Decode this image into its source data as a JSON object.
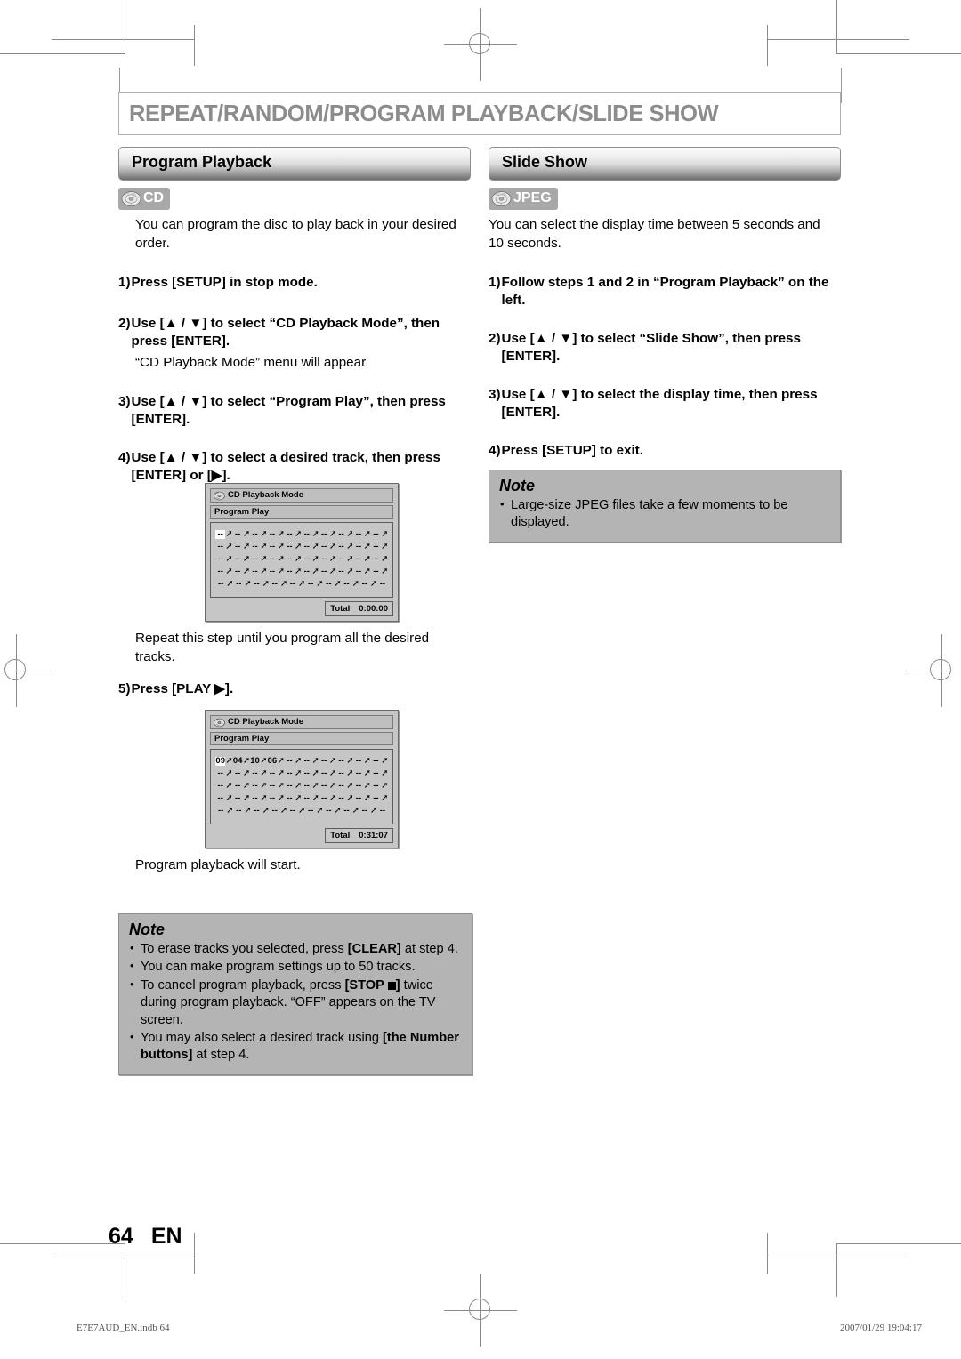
{
  "chapter": {
    "title": "REPEAT/RANDOM/PROGRAM PLAYBACK/SLIDE SHOW"
  },
  "left": {
    "section_title": "Program Playback",
    "badge": {
      "icon": "disc-icon",
      "label": "CD"
    },
    "intro": "You can program the disc to play back in your desired order.",
    "steps": [
      {
        "num": "1)",
        "text": "Press [SETUP] in stop mode."
      },
      {
        "num": "2)",
        "text": "Use [▲ / ▼] to select “CD Playback Mode”, then press [ENTER].",
        "sub": "“CD Playback Mode” menu will appear."
      },
      {
        "num": "3)",
        "text": "Use [▲ / ▼] to select “Program Play”, then press [ENTER]."
      },
      {
        "num": "4)",
        "text": "Use [▲ / ▼] to select a desired track, then press [ENTER] or [▶]."
      }
    ],
    "after_screen1": "Repeat this step until you program all the desired tracks.",
    "step5": {
      "num": "5)",
      "text": "Press [PLAY ▶]."
    },
    "after_screen2": "Program playback will start.",
    "note": {
      "title": "Note",
      "items": [
        "To erase tracks you selected, press <b>[CLEAR]</b> at step 4.",
        "You can make program settings up to 50 tracks.",
        "To cancel program playback, press <b>[STOP <span class=\"sq\"></span>]</b> twice during program playback. “OFF” appears on the TV screen.",
        "You may also select a desired track using <b>[the Number buttons]</b> at step 4."
      ]
    }
  },
  "right": {
    "section_title": "Slide Show",
    "badge": {
      "icon": "disc-icon",
      "label": "JPEG"
    },
    "intro": "You can select the display time between 5 seconds and 10 seconds.",
    "steps": [
      {
        "num": "1)",
        "text": "Follow steps 1 and 2 in “Program Playback” on the left."
      },
      {
        "num": "2)",
        "text": "Use [▲ / ▼] to select “Slide Show”, then press [ENTER]."
      },
      {
        "num": "3)",
        "text": "Use [▲ / ▼] to select the display time, then press [ENTER]."
      },
      {
        "num": "4)",
        "text": "Press [SETUP] to exit."
      }
    ],
    "note": {
      "title": "Note",
      "items": [
        "Large-size JPEG files take a few moments to be displayed."
      ]
    }
  },
  "osd_screens": [
    {
      "title": "CD Playback Mode",
      "subtitle": "Program Play",
      "rows": [
        [
          "--",
          "--",
          "--",
          "--",
          "--",
          "--",
          "--",
          "--",
          "--",
          "--"
        ],
        [
          "--",
          "--",
          "--",
          "--",
          "--",
          "--",
          "--",
          "--",
          "--",
          "--"
        ],
        [
          "--",
          "--",
          "--",
          "--",
          "--",
          "--",
          "--",
          "--",
          "--",
          "--"
        ],
        [
          "--",
          "--",
          "--",
          "--",
          "--",
          "--",
          "--",
          "--",
          "--",
          "--"
        ],
        [
          "--",
          "--",
          "--",
          "--",
          "--",
          "--",
          "--",
          "--",
          "--",
          "--"
        ]
      ],
      "selected": [
        0,
        0
      ],
      "total_label": "Total",
      "total_value": "0:00:00"
    },
    {
      "title": "CD Playback Mode",
      "subtitle": "Program Play",
      "rows": [
        [
          "09",
          "04",
          "10",
          "06",
          "--",
          "--",
          "--",
          "--",
          "--",
          "--"
        ],
        [
          "--",
          "--",
          "--",
          "--",
          "--",
          "--",
          "--",
          "--",
          "--",
          "--"
        ],
        [
          "--",
          "--",
          "--",
          "--",
          "--",
          "--",
          "--",
          "--",
          "--",
          "--"
        ],
        [
          "--",
          "--",
          "--",
          "--",
          "--",
          "--",
          "--",
          "--",
          "--",
          "--"
        ],
        [
          "--",
          "--",
          "--",
          "--",
          "--",
          "--",
          "--",
          "--",
          "--",
          "--"
        ]
      ],
      "selected": [
        0,
        0
      ],
      "total_label": "Total",
      "total_value": "0:31:07"
    }
  ],
  "page_number": {
    "number": "64",
    "lang": "EN"
  },
  "footer": {
    "left": "E7E7AUD_EN.indb   64",
    "right": "2007/01/29   19:04:17"
  }
}
